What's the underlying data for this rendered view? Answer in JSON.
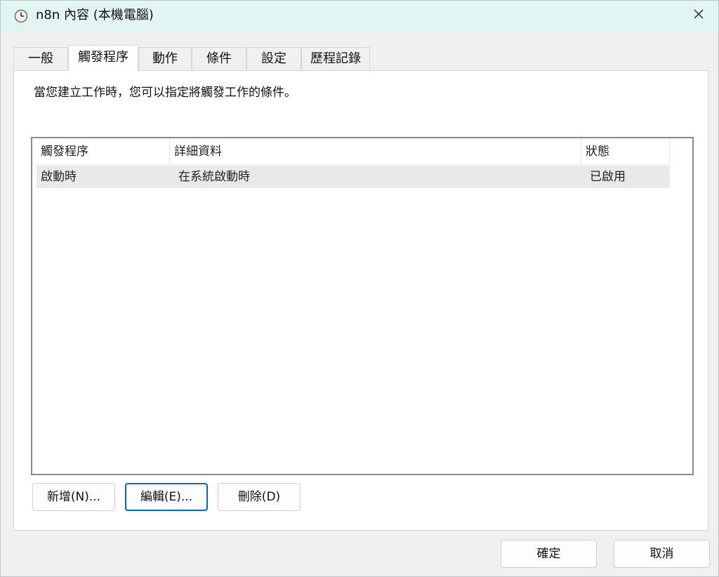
{
  "window": {
    "title": "n8n 內容 (本機電腦)"
  },
  "tabs": [
    {
      "label": "一般"
    },
    {
      "label": "觸發程序"
    },
    {
      "label": "動作"
    },
    {
      "label": "條件"
    },
    {
      "label": "設定"
    },
    {
      "label": "歷程記錄"
    }
  ],
  "active_tab": "觸發程序",
  "panel": {
    "description": "當您建立工作時，您可以指定將觸發工作的條件。",
    "columns": [
      "觸發程序",
      "詳細資料",
      "狀態"
    ],
    "rows": [
      {
        "trigger": "啟動時",
        "details": "在系統啟動時",
        "status": "已啟用"
      }
    ],
    "buttons": {
      "new": "新增(N)...",
      "edit": "編輯(E)...",
      "delete": "刪除(D)"
    }
  },
  "footer": {
    "ok": "確定",
    "cancel": "取消"
  },
  "colors": {
    "titlebar": "#e3f5f2",
    "focus": "#0067c0",
    "selected_row": "#e9e9e9"
  },
  "icons": {
    "app": "clock-icon",
    "close": "close-icon"
  }
}
